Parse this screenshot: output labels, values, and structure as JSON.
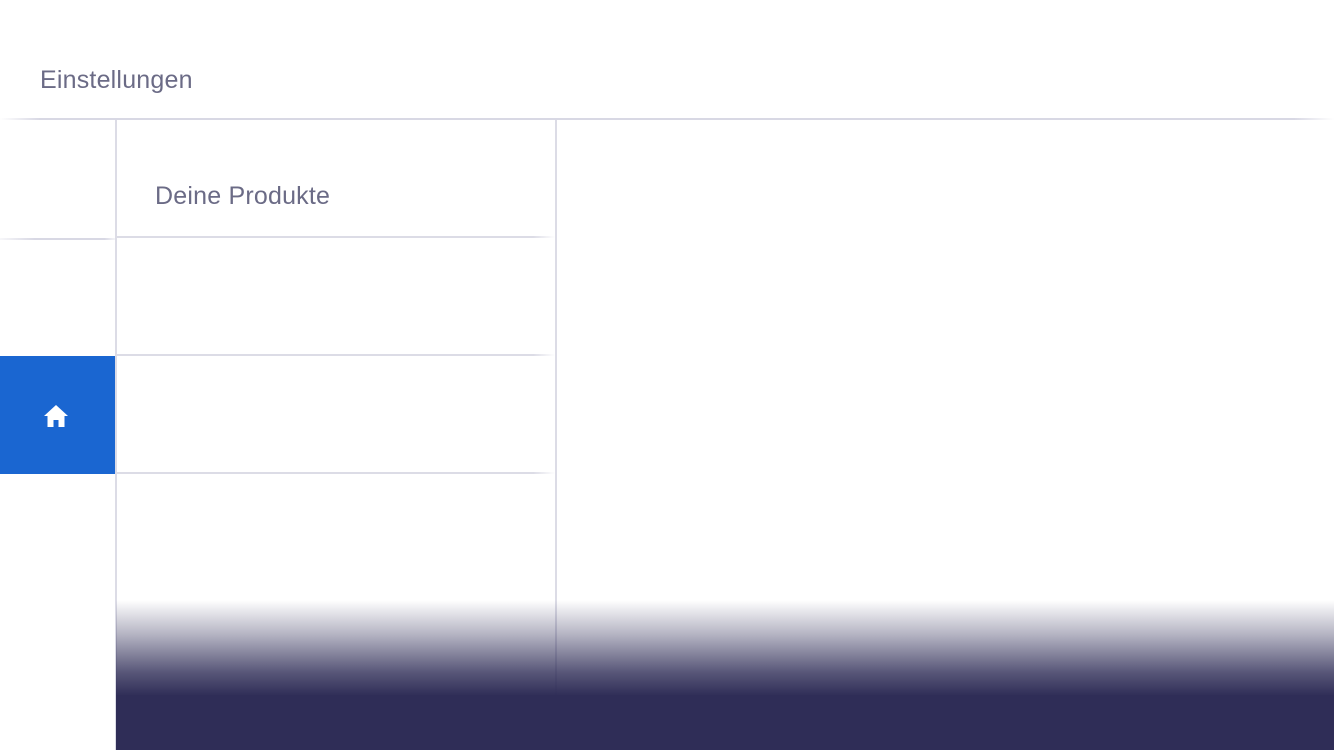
{
  "header": {
    "title": "Einstellungen"
  },
  "rail": {
    "items": [
      {
        "icon": "",
        "active": false
      },
      {
        "icon": "",
        "active": false
      },
      {
        "icon": "home-icon",
        "active": true
      }
    ]
  },
  "list": {
    "rows": [
      {
        "label": "Deine Produkte"
      },
      {
        "label": ""
      },
      {
        "label": ""
      }
    ]
  },
  "colors": {
    "accent": "#1a66d1",
    "footer": "#2f2d57",
    "text_muted": "#6b6b86",
    "divider": "#dcdce6"
  }
}
